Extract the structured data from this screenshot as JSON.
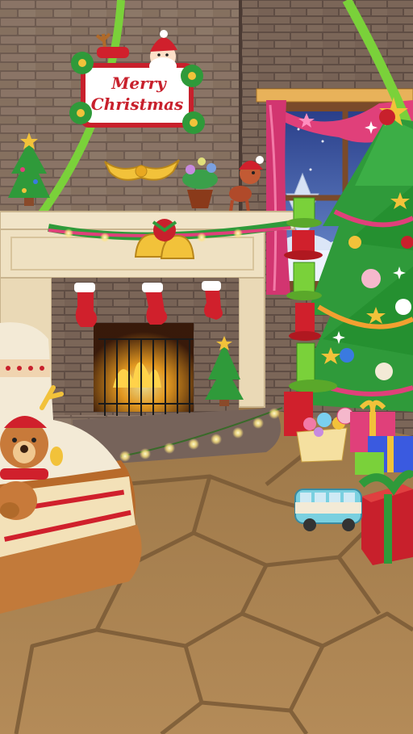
{
  "scene": {
    "sign": {
      "line1": "Merry",
      "line2": "Christmas"
    }
  },
  "colors": {
    "wall_brick": "#8a7466",
    "mortar": "#6e5b50",
    "floor": "#a98354",
    "floor_crack": "#7a5a36",
    "mantel": "#f1e4c8",
    "curtain": "#e0407a",
    "tree_green": "#2f9a3a",
    "ribbon_green": "#7ad13a",
    "gold": "#f2c23a",
    "sign_red": "#c8202c"
  },
  "icons": [
    "santa-icon",
    "bell-icon",
    "stocking-icon",
    "christmas-tree-icon",
    "teddy-bear-icon",
    "toy-bus-icon",
    "gift-box-icon",
    "candy-basket-icon",
    "reindeer-toy-icon",
    "star-icon"
  ]
}
